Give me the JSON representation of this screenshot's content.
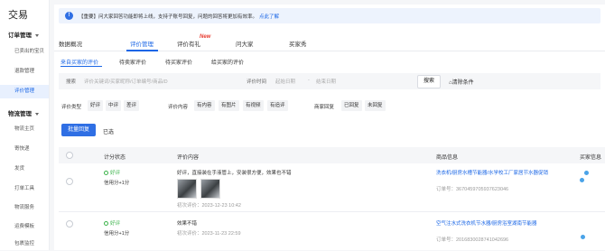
{
  "sidebar": {
    "title": "交易",
    "group1": "订单管理",
    "items1": [
      "已卖出的宝贝",
      "退款管理",
      "评价管理"
    ],
    "group2": "物流管理",
    "items2": [
      "物流主页",
      "寄快递",
      "发货",
      "打单工具",
      "物流服务",
      "运费模板",
      "包裹监控"
    ]
  },
  "notice": {
    "text": "【重要】问大家回答功能即将上线，支持子账号回复，问题的回答将更加有效率。",
    "link": "点此了解"
  },
  "tabs": [
    "数据概况",
    "评价管理",
    "评价有礼",
    "问大家",
    "买家秀"
  ],
  "tab_badge": "New",
  "subtabs": [
    "来自买家的评价",
    "待卖家评价",
    "待买家评价",
    "给买家的评价"
  ],
  "filter": {
    "search_label": "搜索",
    "search_placeholder": "评价关键词/买家昵称/订单编号/商品ID",
    "time_label": "评价时间",
    "start_placeholder": "起始日期",
    "end_placeholder": "结束日期",
    "search_button": "搜索",
    "clear_button": "清除条件"
  },
  "row2": {
    "type_label": "评价类型",
    "types": [
      "好评",
      "中评",
      "差评"
    ],
    "content_label": "评价内容",
    "contents": [
      "有内容",
      "有图片",
      "有视频",
      "有追评"
    ],
    "reply_label": "商家回复",
    "replies": [
      "已回复",
      "未回复"
    ]
  },
  "actions": {
    "batch_reply": "批量回复",
    "selected": "已选"
  },
  "table": {
    "headers": [
      "计分状态",
      "评价内容",
      "商品信息",
      "买家信息"
    ],
    "rows": [
      {
        "rating": "好评",
        "credit": "信用分+1分",
        "content": "好评，直接装在手液管上，安装很方便，效果也不错",
        "time": "初次评价：2023-12-23 10:42",
        "product": "洗衣机/厨房水槽节能器/水学校工厂家居节水器促销",
        "order": "订单号：3670459705937623046"
      },
      {
        "rating": "好评",
        "credit": "信用分+1分",
        "content": "效果不错",
        "time": "初次评价：2023-11-23 22:59",
        "product": "空气注水式洗衣机节水器/厨房浴室湖南节能器",
        "order": "订单号：2016830028741042696"
      }
    ]
  }
}
